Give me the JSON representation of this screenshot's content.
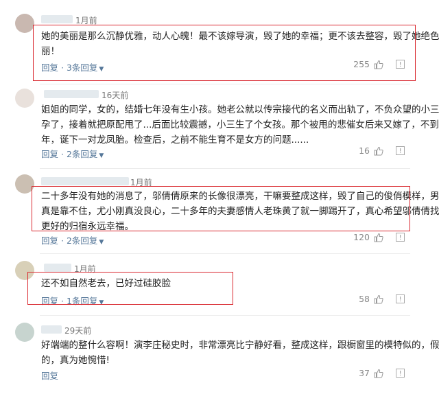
{
  "ui": {
    "reply_label": "回复",
    "more_glyph": "⌄"
  },
  "comments": [
    {
      "time": "1月前",
      "lines": [
        "她的美丽是那么沉静优雅，动人心魄！最不该嫁导演，毁了她的幸福；更不该去整容，毁了她绝色美",
        "丽！"
      ],
      "replies": "3条回复",
      "likes": "255",
      "highlighted": true
    },
    {
      "time": "16天前",
      "lines": [
        "姐姐的同学，女的，结婚七年没有生小孩。她老公就以传宗接代的名义而出轨了，不负众望的小三怀",
        "孕了，接着就把原配甩了...后面比较震撼，小三生了个女孩。那个被甩的悲催女后来又嫁了，不到一",
        "年，诞下一对龙凤胎。检查后，之前不能生育不是女方的问题......"
      ],
      "replies": "2条回复",
      "likes": "16",
      "highlighted": false
    },
    {
      "time": "1月前",
      "lines": [
        "二十多年没有她的消息了，邬倩倩原来的长像很漂亮，干嘛要整成这样，毁了自己的俊俏模样，男人",
        "真是靠不住，尤小刚真没良心，二十多年的夫妻感情人老珠黄了就一脚踢开了，真心希望邬倩倩找到",
        "更好的归宿永远幸福。"
      ],
      "replies": "2条回复",
      "likes": "120",
      "highlighted": true
    },
    {
      "time": "1月前",
      "lines": [
        "还不如自然老去，已好过硅胶脸"
      ],
      "replies": "1条回复",
      "likes": "58",
      "highlighted": true
    },
    {
      "time": "29天前",
      "lines": [
        "好端端的整什么容啊！演李庄秘史时，非常漂亮比宁静好看，整成这样，跟橱窗里的模特似的，假假",
        "的，真为她惋惜!"
      ],
      "replies": "",
      "likes": "37",
      "highlighted": false
    }
  ]
}
